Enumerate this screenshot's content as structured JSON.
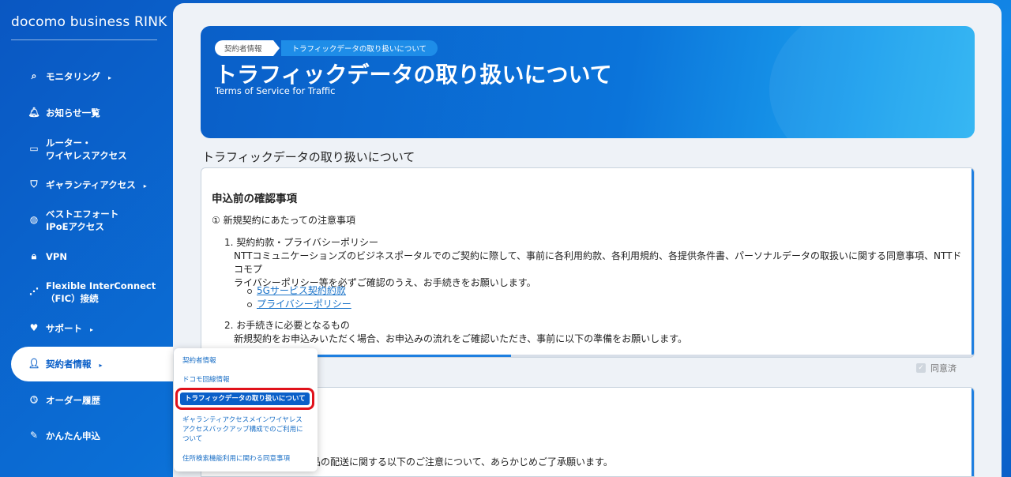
{
  "app": {
    "brand": "docomo business RINK"
  },
  "sidebar": {
    "items": [
      {
        "label": "モニタリング",
        "icon": "monitor-search-icon",
        "chevron": "▸"
      },
      {
        "label": "お知らせ一覧",
        "icon": "bell-icon"
      },
      {
        "label_line1": "ルーター・",
        "label_line2": "ワイヤレスアクセス",
        "icon": "router-icon"
      },
      {
        "label": "ギャランティアクセス",
        "icon": "shield-icon",
        "chevron": "▸"
      },
      {
        "label_line1": "ベストエフォート",
        "label_line2": "IPoEアクセス",
        "icon": "globe-icon"
      },
      {
        "label": "VPN",
        "icon": "lock-icon"
      },
      {
        "label_line1": "Flexible InterConnect",
        "label_line2": "（FIC）接続",
        "icon": "network-icon"
      },
      {
        "label": "サポート",
        "icon": "heart-hand-icon",
        "chevron": "▸"
      },
      {
        "label": "契約者情報",
        "icon": "person-icon",
        "chevron": "▸"
      },
      {
        "label": "オーダー履歴",
        "icon": "clock-icon"
      },
      {
        "label": "かんたん申込",
        "icon": "edit-icon"
      }
    ]
  },
  "submenu": {
    "items": [
      "契約者情報",
      "ドコモ回線情報",
      "トラフィックデータの取り扱いについて",
      "ギャランティアクセスメインワイヤレスアクセスバックアップ構成でのご利用について",
      "住所検索機能利用に関わる同意事項"
    ],
    "item4_lines": [
      "ギャランティアクセスメインワイヤレス",
      "アクセスバックアップ構成でのご利用に",
      "ついて"
    ]
  },
  "hero": {
    "breadcrumb": [
      "契約者情報",
      "トラフィックデータの取り扱いについて"
    ],
    "title": "トラフィックデータの取り扱いについて",
    "subtitle": "Terms of Service for Traffic"
  },
  "main": {
    "section_title": "トラフィックデータの取り扱いについて",
    "card": {
      "heading": "申込前の確認事項",
      "note1": "① 新規契約にあたっての注意事項",
      "item1_title": "1. 契約約款・プライバシーポリシー",
      "item1_body_line1": "NTTコミュニケーションズのビジネスポータルでのご契約に際して、事前に各利用約款、各利用規約、各提供条件書、パーソナルデータの取扱いに関する同意事項、NTTドコモプ",
      "item1_body_line2": "ライバシーポリシー等を必ずご確認のうえ、お手続きをお願いします。",
      "links": [
        "5Gサービス契約約款",
        "プライバシーポリシー"
      ],
      "item2_title": "2. お手続きに必要となるもの",
      "item2_body": "新規契約をお申込みいただく場合、お申込みの流れをご確認いただき、事前に以下の準備をお願いします。"
    },
    "agree_label": "同意済",
    "card2_text": "の商品の配送に関する以下のご注意について、あらかじめご了承願います。"
  }
}
